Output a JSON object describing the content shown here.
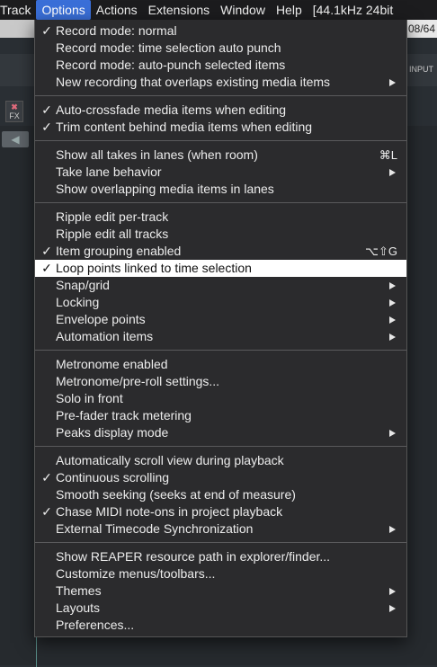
{
  "menubar": {
    "items": [
      "Track",
      "Options",
      "Actions",
      "Extensions",
      "Window",
      "Help"
    ],
    "status": "[44.1kHz 24bit"
  },
  "background": {
    "time_text": "08/64",
    "input_label": "INPUT",
    "fx_label": "FX"
  },
  "menu": {
    "groups": [
      [
        {
          "label": "Record mode: normal",
          "checked": true
        },
        {
          "label": "Record mode: time selection auto punch"
        },
        {
          "label": "Record mode: auto-punch selected items"
        },
        {
          "label": "New recording that overlaps existing media items",
          "submenu": true
        }
      ],
      [
        {
          "label": "Auto-crossfade media items when editing",
          "checked": true
        },
        {
          "label": "Trim content behind media items when editing",
          "checked": true
        }
      ],
      [
        {
          "label": "Show all takes in lanes (when room)",
          "shortcut": "⌘L"
        },
        {
          "label": "Take lane behavior",
          "submenu": true
        },
        {
          "label": "Show overlapping media items in lanes"
        }
      ],
      [
        {
          "label": "Ripple edit per-track"
        },
        {
          "label": "Ripple edit all tracks"
        },
        {
          "label": "Item grouping enabled",
          "checked": true,
          "shortcut": "⌥⇧G"
        },
        {
          "label": "Loop points linked to time selection",
          "checked": true,
          "highlighted": true
        },
        {
          "label": "Snap/grid",
          "submenu": true
        },
        {
          "label": "Locking",
          "submenu": true
        },
        {
          "label": "Envelope points",
          "submenu": true
        },
        {
          "label": "Automation items",
          "submenu": true
        }
      ],
      [
        {
          "label": "Metronome enabled"
        },
        {
          "label": "Metronome/pre-roll settings..."
        },
        {
          "label": "Solo in front"
        },
        {
          "label": "Pre-fader track metering"
        },
        {
          "label": "Peaks display mode",
          "submenu": true
        }
      ],
      [
        {
          "label": "Automatically scroll view during playback"
        },
        {
          "label": "Continuous scrolling",
          "checked": true
        },
        {
          "label": "Smooth seeking (seeks at end of measure)"
        },
        {
          "label": "Chase MIDI note-ons in project playback",
          "checked": true
        },
        {
          "label": "External Timecode Synchronization",
          "submenu": true
        }
      ],
      [
        {
          "label": "Show REAPER resource path in explorer/finder..."
        },
        {
          "label": "Customize menus/toolbars..."
        },
        {
          "label": "Themes",
          "submenu": true
        },
        {
          "label": "Layouts",
          "submenu": true
        },
        {
          "label": "Preferences..."
        }
      ]
    ]
  },
  "colors": {
    "menubar_active": "#3a6fd8",
    "menu_bg": "#2b2b2d",
    "highlight_bg": "#ffffff"
  }
}
